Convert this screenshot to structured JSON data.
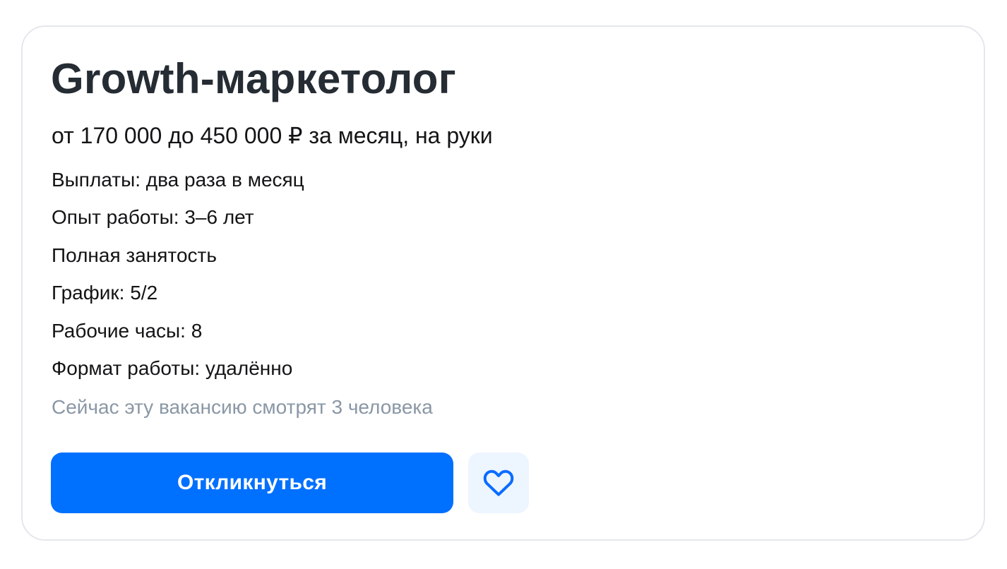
{
  "vacancy": {
    "title": "Growth-маркетолог",
    "salary": "от 170 000 до 450 000 ₽ за месяц, на руки",
    "details": [
      "Выплаты: два раза в месяц",
      "Опыт работы: 3–6 лет",
      "Полная занятость",
      "График: 5/2",
      "Рабочие часы: 8",
      "Формат работы: удалённо"
    ],
    "viewers": "Сейчас эту вакансию смотрят 3 человека"
  },
  "actions": {
    "apply_label": "Откликнуться",
    "favorite_icon": "heart-outline-icon"
  },
  "colors": {
    "accent": "#0070ff",
    "favorite_bg": "#edf5ff",
    "muted_text": "#8a97a5",
    "title_text": "#262c33"
  }
}
